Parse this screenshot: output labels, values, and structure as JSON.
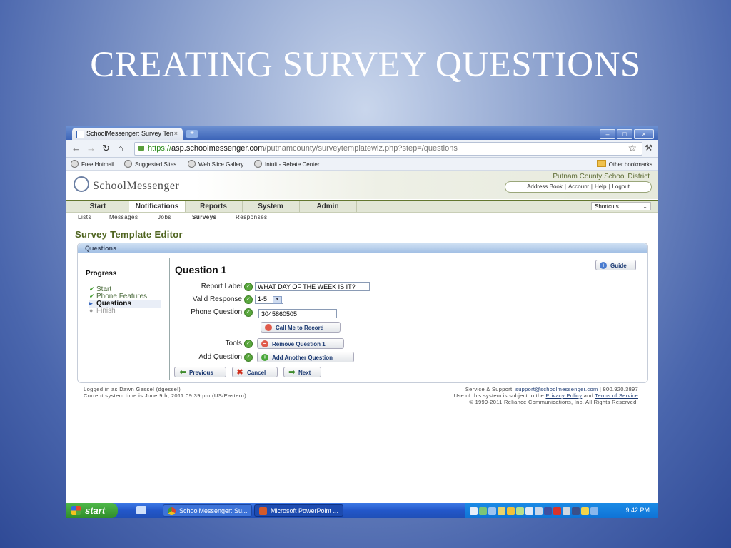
{
  "slide": {
    "title": "CREATING SURVEY QUESTIONS"
  },
  "browser": {
    "tab_title": "SchoolMessenger: Survey Ten",
    "tab_close": "×",
    "new_tab": "+",
    "win_minimize": "–",
    "win_restore": "□",
    "win_close": "×",
    "url_scheme": "https://",
    "url_host": "asp.schoolmessenger.com",
    "url_path": "/putnamcounty/surveytemplatewiz.php?step=/questions",
    "bookmarks": [
      "Free Hotmail",
      "Suggested Sites",
      "Web Slice Gallery",
      "Intuit - Rebate Center"
    ],
    "other_bookmarks": "Other bookmarks"
  },
  "app": {
    "logo": "SchoolMessenger",
    "district": "Putnam County School District",
    "account_links": [
      "Address Book",
      "Account",
      "Help",
      "Logout"
    ],
    "nav": [
      "Start",
      "Notifications",
      "Reports",
      "System",
      "Admin"
    ],
    "shortcuts": "Shortcuts",
    "subnav": [
      "Lists",
      "Messages",
      "Jobs",
      "Surveys",
      "Responses"
    ],
    "page_title": "Survey Template Editor",
    "panel_title": "Questions",
    "guide": "Guide",
    "progress": {
      "title": "Progress",
      "steps": [
        "Start",
        "Phone Features",
        "Questions",
        "Finish"
      ]
    },
    "question": {
      "title": "Question 1",
      "report_label_lbl": "Report Label",
      "report_label_val": "WHAT DAY OF THE WEEK IS IT?",
      "valid_response_lbl": "Valid Response",
      "valid_response_val": "1-5",
      "phone_question_lbl": "Phone Question",
      "phone_question_val": "3045860505",
      "call_btn": "Call Me to Record",
      "tools_lbl": "Tools",
      "remove_btn": "Remove Question 1",
      "add_lbl": "Add Question",
      "add_btn": "Add Another Question"
    },
    "buttons": {
      "previous": "Previous",
      "cancel": "Cancel",
      "next": "Next"
    },
    "footer": {
      "logged_in": "Logged in as Dawn Gessel (dgessel)",
      "time": "Current system time is June 9th, 2011 09:39 pm (US/Eastern)",
      "support_prefix": "Service & Support: ",
      "support_email": "support@schoolmessenger.com",
      "support_phone": " | 800.920.3897",
      "policy_prefix": "Use of this system is subject to the ",
      "privacy": "Privacy Policy",
      "and": " and ",
      "terms": "Terms of Service",
      "copyright": "© 1999-2011 Reliance Communications, Inc. All Rights Reserved."
    }
  },
  "taskbar": {
    "start": "start",
    "tasks": [
      "SchoolMessenger: Su...",
      "Microsoft PowerPoint ..."
    ],
    "clock": "9:42 PM"
  }
}
